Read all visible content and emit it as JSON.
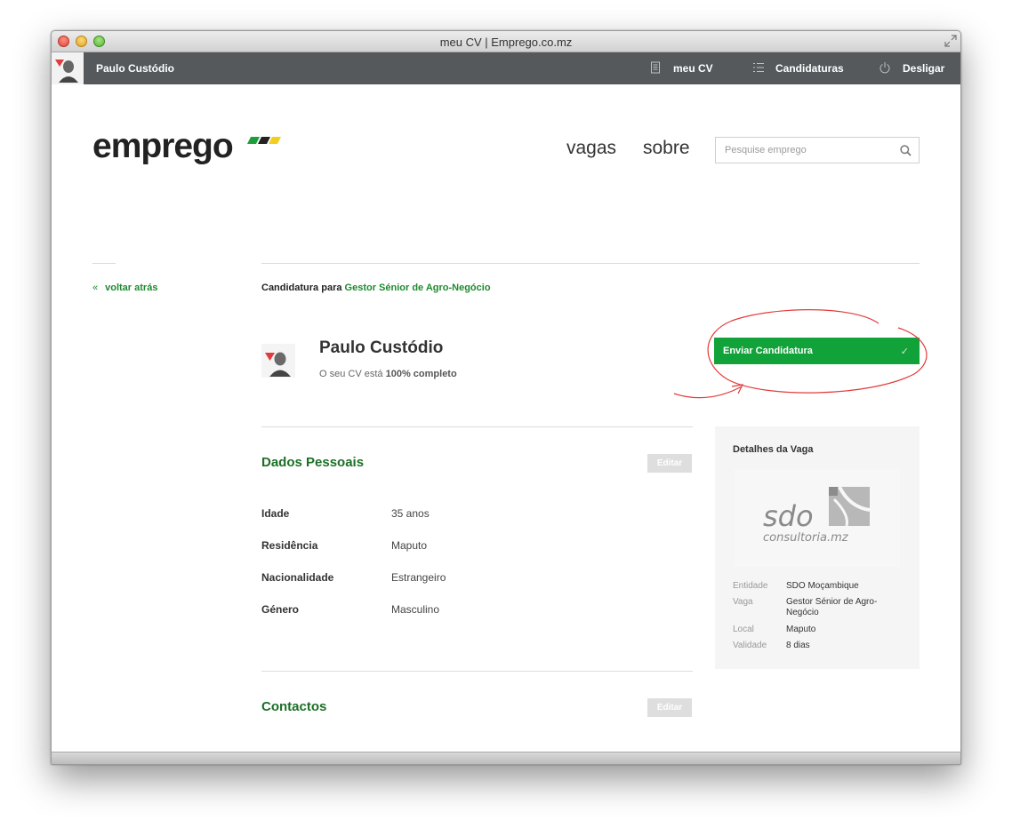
{
  "window": {
    "title": "meu CV | Emprego.co.mz"
  },
  "topnav": {
    "user_name": "Paulo Custódio",
    "links": [
      {
        "label": "meu CV",
        "icon": "document-icon"
      },
      {
        "label": "Candidaturas",
        "icon": "list-icon"
      },
      {
        "label": "Desligar",
        "icon": "power-icon"
      }
    ]
  },
  "header": {
    "logo": "emprego",
    "nav": [
      "vagas",
      "sobre"
    ],
    "search_placeholder": "Pesquise emprego"
  },
  "application": {
    "back_label": "voltar atrás",
    "prefix": "Candidatura para",
    "job_title": "Gestor Sénior de Agro-Negócio",
    "name": "Paulo Custódio",
    "status_prefix": "O seu CV está",
    "status_value": "100% completo",
    "submit_label": "Enviar Candidatura"
  },
  "sections": {
    "personal": {
      "title": "Dados Pessoais",
      "edit_label": "Editar",
      "fields": [
        {
          "label": "Idade",
          "value": "35 anos"
        },
        {
          "label": "Residência",
          "value": "Maputo"
        },
        {
          "label": "Nacionalidade",
          "value": "Estrangeiro"
        },
        {
          "label": "Género",
          "value": "Masculino"
        }
      ]
    },
    "contacts": {
      "title": "Contactos",
      "edit_label": "Editar"
    }
  },
  "job_details": {
    "title": "Detalhes da Vaga",
    "company_logo_text": "sdo",
    "company_logo_subtext": "consultoria.mz",
    "rows": [
      {
        "label": "Entidade",
        "value": "SDO Moçambique"
      },
      {
        "label": "Vaga",
        "value": "Gestor Sénior de Agro-Negócio"
      },
      {
        "label": "Local",
        "value": "Maputo"
      },
      {
        "label": "Validade",
        "value": "8 dias"
      }
    ]
  },
  "colors": {
    "brand_green": "#12a23a",
    "nav_bg": "#55595c",
    "annotation_red": "#e23b3b"
  }
}
